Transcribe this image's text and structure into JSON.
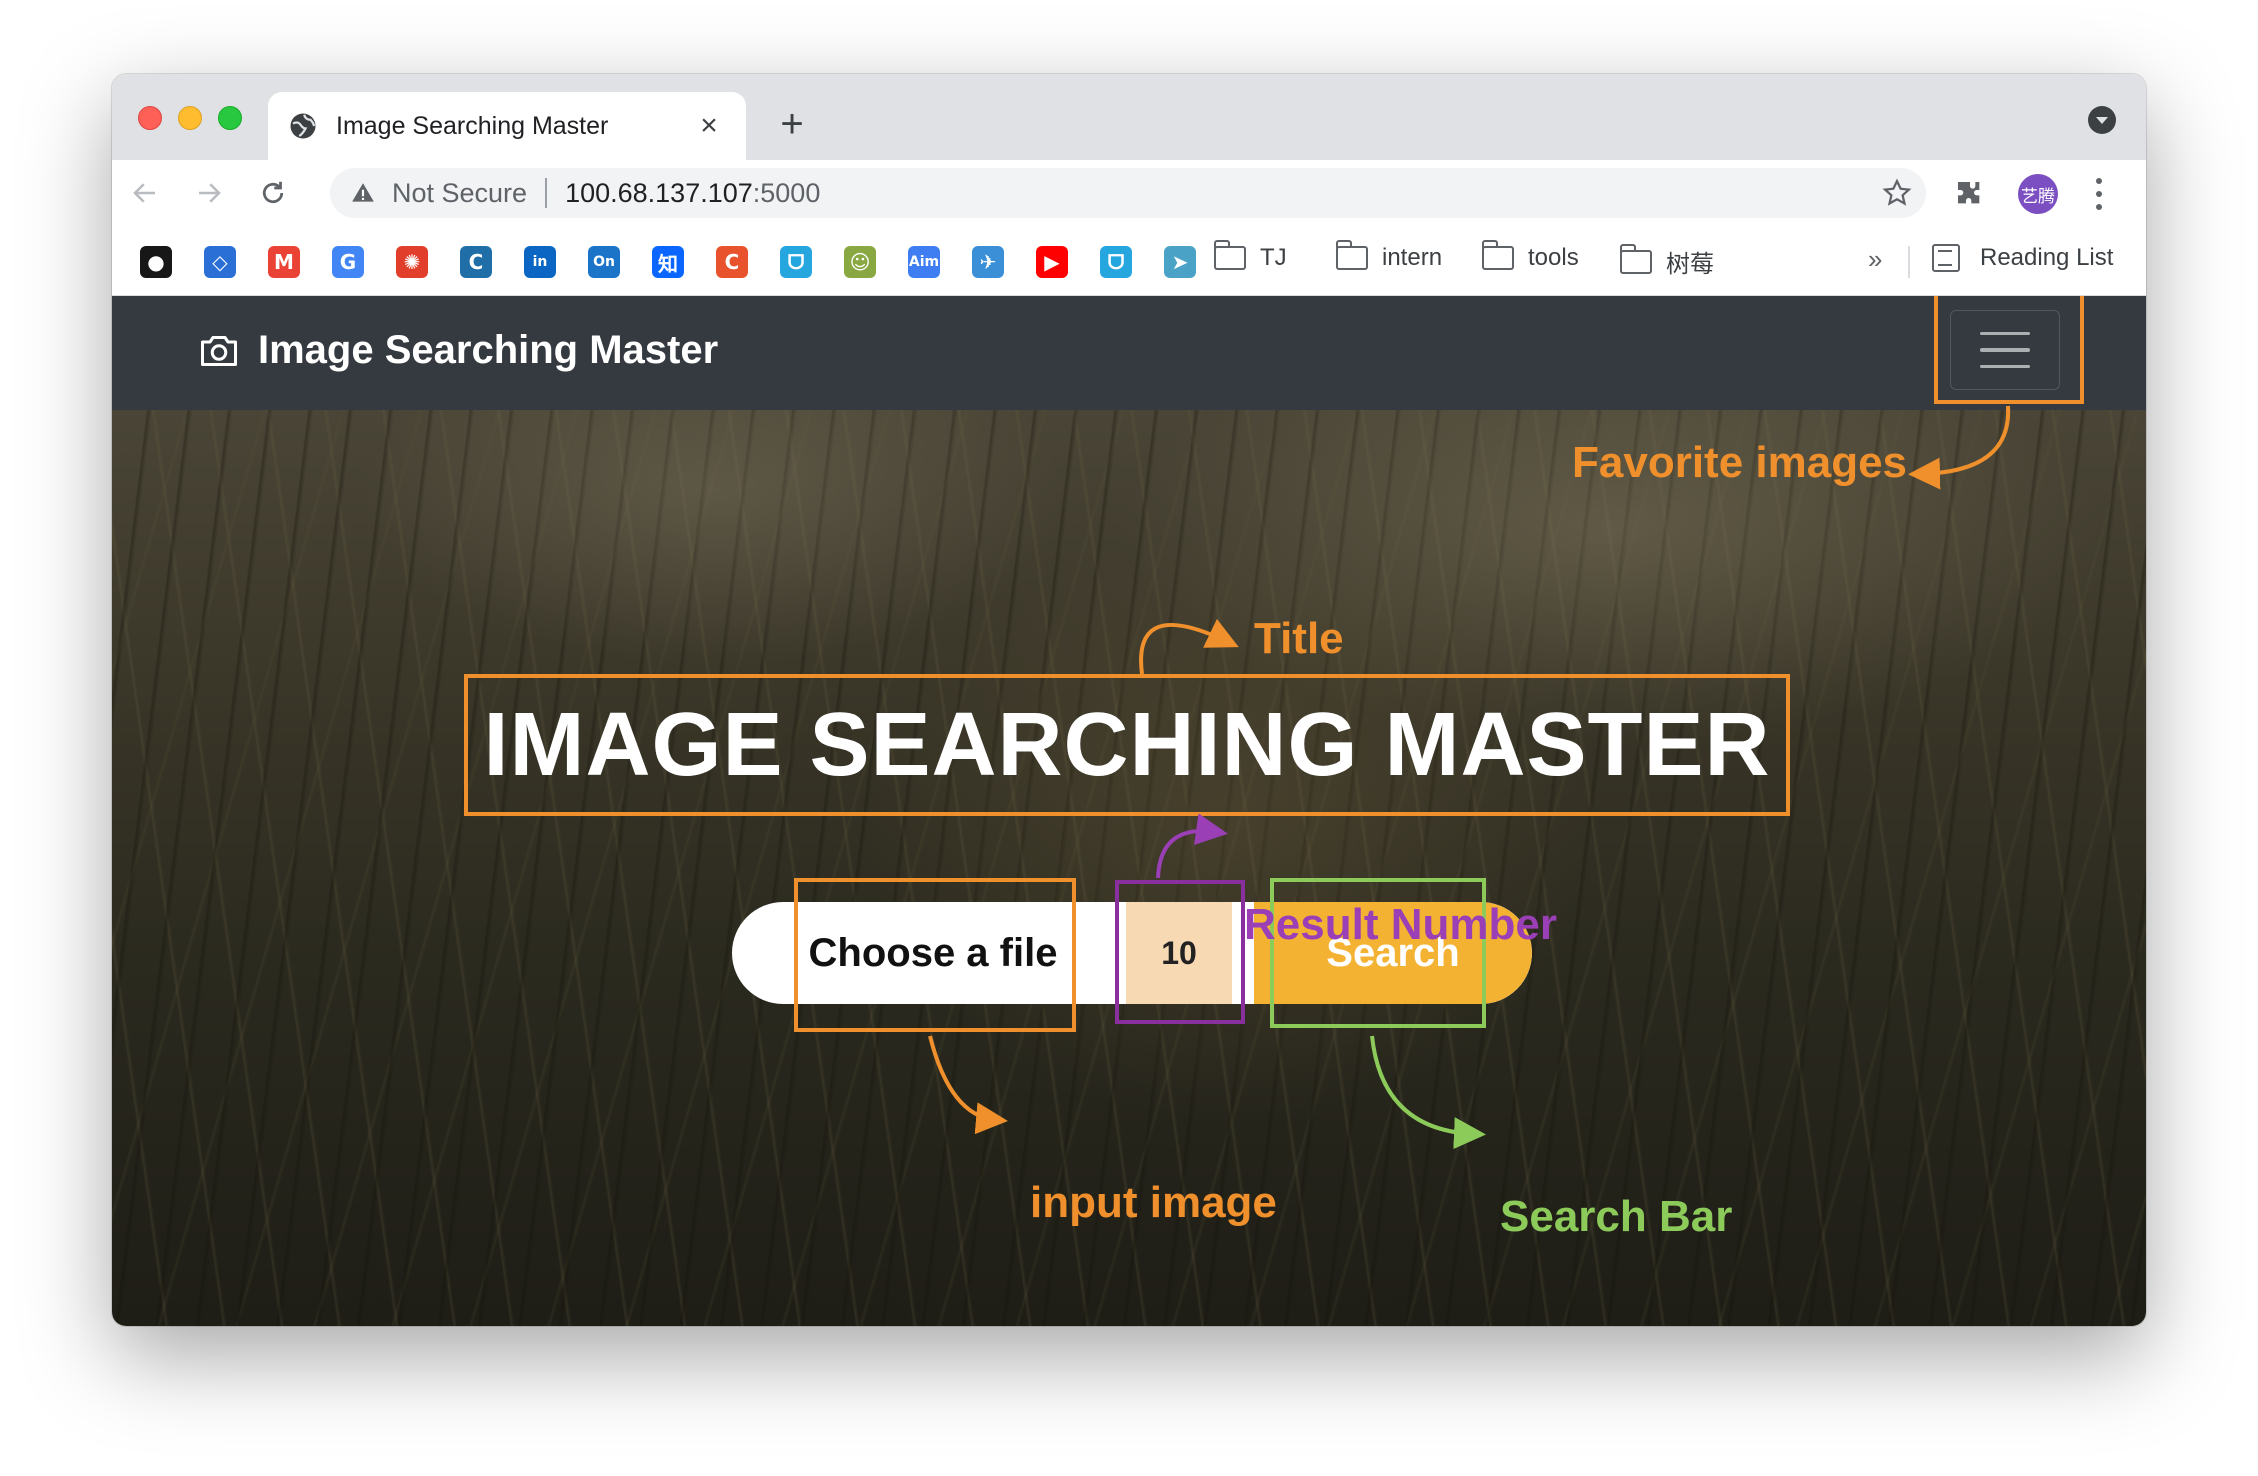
{
  "browser": {
    "tab": {
      "title": "Image Searching Master",
      "close": "×"
    },
    "new_tab": "+",
    "address": {
      "security": "Not Secure",
      "host": "100.68.137.107",
      "port": ":5000"
    },
    "avatar_text": "艺腾",
    "bookmarks": {
      "folders": [
        "TJ",
        "intern",
        "tools",
        "树莓"
      ],
      "more": "»",
      "reading_list": "Reading List",
      "icons": [
        {
          "name": "github-icon",
          "glyph": "",
          "color": "#181717"
        },
        {
          "name": "diamond-icon",
          "glyph": "◇",
          "color": "#2a6fd6"
        },
        {
          "name": "gmail-icon",
          "glyph": "M",
          "color": "#ea4335"
        },
        {
          "name": "google-translate-icon",
          "glyph": "G",
          "color": "#4285f4"
        },
        {
          "name": "canvas-icon",
          "glyph": "✺",
          "color": "#e13f2b"
        },
        {
          "name": "c-icon",
          "glyph": "C",
          "color": "#1f6ea8"
        },
        {
          "name": "linkedin-icon",
          "glyph": "in",
          "color": "#0a66c2"
        },
        {
          "name": "onenote-icon",
          "glyph": "On",
          "color": "#1c74c8"
        },
        {
          "name": "zhihu-icon",
          "glyph": "知",
          "color": "#0a66ff"
        },
        {
          "name": "c-red-icon",
          "glyph": "C",
          "color": "#e8532e"
        },
        {
          "name": "bilibili-icon",
          "glyph": "ᗜ",
          "color": "#25a6de"
        },
        {
          "name": "frog-icon",
          "glyph": "☺",
          "color": "#8aa842"
        },
        {
          "name": "aim-icon",
          "glyph": "Aim",
          "color": "#3e7ef2"
        },
        {
          "name": "bird-icon",
          "glyph": "✈",
          "color": "#3a8fd6"
        },
        {
          "name": "youtube-icon",
          "glyph": "▶",
          "color": "#ff0000"
        },
        {
          "name": "bilibili-tv-icon",
          "glyph": "ᗜ",
          "color": "#25a6de"
        },
        {
          "name": "telegram-icon",
          "glyph": "➤",
          "color": "#4aa3c6"
        }
      ]
    }
  },
  "app": {
    "brand": "Image Searching Master",
    "hero_title": "IMAGE SEARCHING MASTER",
    "search_bar": {
      "file_label": "Choose a file",
      "result_number": "10",
      "search_label": "Search"
    }
  },
  "annotations": {
    "favorite": "Favorite images",
    "title": "Title",
    "result_number": "Result Number",
    "input_image": "input image",
    "search_bar": "Search Bar",
    "colors": {
      "orange": "#f0902c",
      "purple": "#9a3fb6",
      "green": "#8ccb5a"
    }
  },
  "colors": {
    "navbar": "#343a40",
    "search_button": "#f4b233",
    "number_field": "#f7d9b3"
  }
}
